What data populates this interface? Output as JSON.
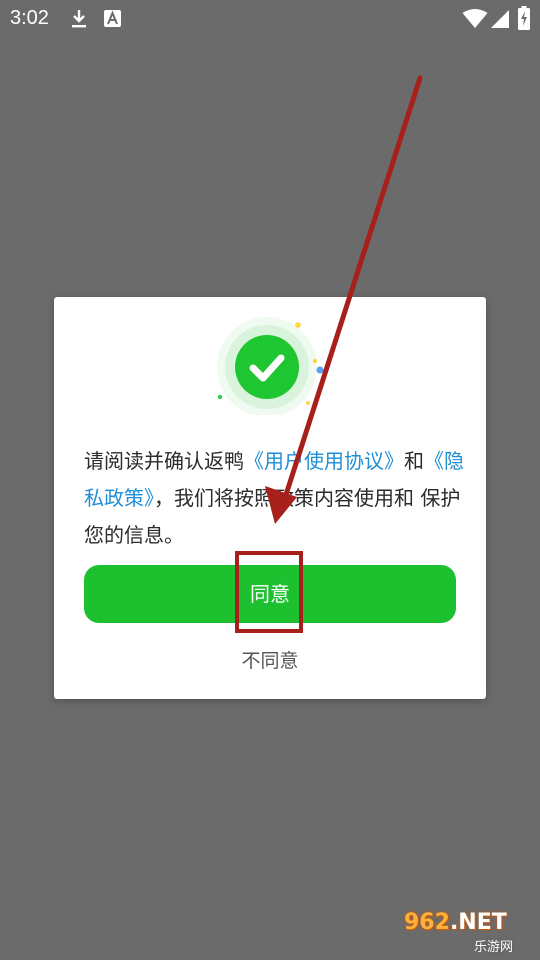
{
  "status_bar": {
    "time": "3:02",
    "icons": [
      "download-icon",
      "a-notification-icon",
      "wifi-icon",
      "signal-icon",
      "battery-charging-icon"
    ]
  },
  "dialog": {
    "icon": "check-circle-icon",
    "text": {
      "part1": "请阅读并确认返鸭",
      "link_user_agreement": "《用户使用协议》",
      "part2": "和",
      "link_privacy_policy": "《隐私政策》",
      "part3": "，我们将按照政策内容使用和 保护您的信息。"
    },
    "agree_button": "同意",
    "disagree_button": "不同意"
  },
  "watermark": {
    "main_prefix": "962",
    "main_suffix": ".NET",
    "sub": "乐游网"
  },
  "colors": {
    "overlay": "#6b6b6b",
    "accent_green": "#1dc12f",
    "link_blue": "#1f8fd6",
    "annotation_red": "#a7201c"
  }
}
